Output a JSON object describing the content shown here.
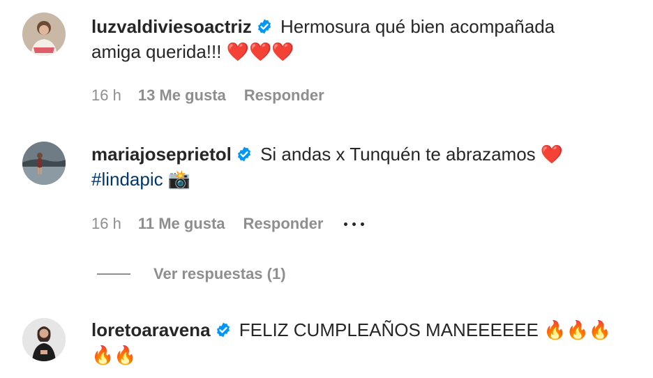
{
  "comments": [
    {
      "username": "luzvaldiviesoactriz",
      "text_line1": "Hermosura qué bien acompañada",
      "text_line2": "amiga querida!!!",
      "emojis": "❤️❤️❤️",
      "time": "16 h",
      "likes": "13 Me gusta",
      "reply": "Responder"
    },
    {
      "username": "mariajoseprietol",
      "text_line1": "Si andas x Tunquén te abrazamos",
      "emoji_after_line1": "❤️",
      "hashtag": "#lindapic",
      "emoji_after_hashtag": "📸",
      "time": "16 h",
      "likes": "11 Me gusta",
      "reply": "Responder",
      "more_icon": "more-horizontal-icon"
    },
    {
      "username": "loretoaravena",
      "text_line1": "FELIZ CUMPLEAÑOS MANEEEEEE",
      "emojis_line1": "🔥🔥🔥",
      "emojis_line2": "🔥🔥"
    }
  ],
  "view_replies": "Ver respuestas (1)",
  "colors": {
    "text": "#262626",
    "secondary": "#8e8e8e",
    "hashtag": "#00376b",
    "verified": "#0095f6"
  }
}
